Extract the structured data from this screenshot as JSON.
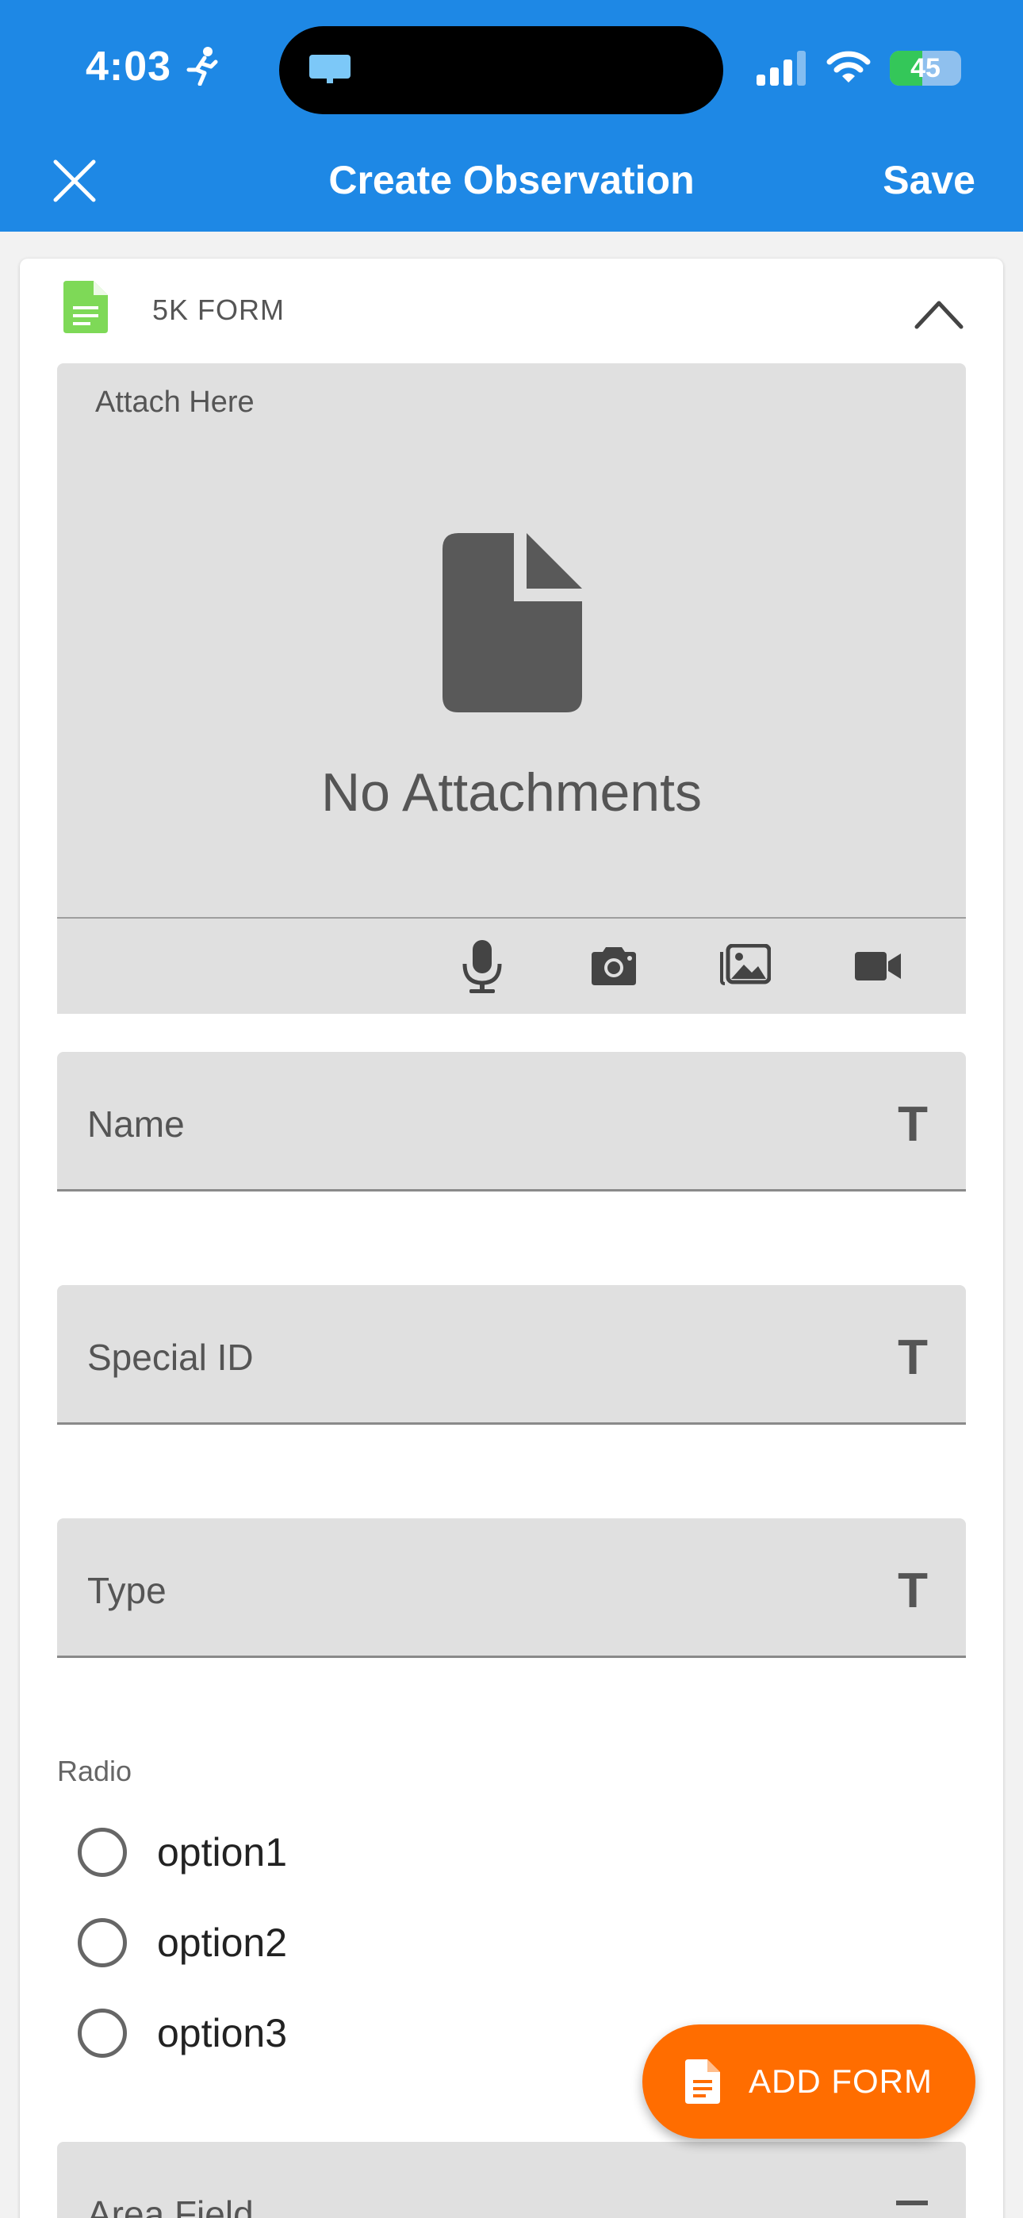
{
  "status_bar": {
    "time": "4:03",
    "battery": "45",
    "battery_level": 0.45
  },
  "header": {
    "title": "Create Observation",
    "save_label": "Save"
  },
  "form": {
    "title": "5K FORM",
    "attachments": {
      "label": "Attach Here",
      "empty_text": "No Attachments"
    },
    "fields": [
      {
        "label": "Name"
      },
      {
        "label": "Special ID"
      },
      {
        "label": "Type"
      }
    ],
    "field_type_glyph": "T",
    "radio": {
      "label": "Radio",
      "options": [
        "option1",
        "option2",
        "option3"
      ]
    },
    "area_field": {
      "label": "Area Field"
    }
  },
  "fab": {
    "label": "ADD FORM"
  },
  "colors": {
    "primary": "#1e88e5",
    "accent": "#ff6d00",
    "form_icon": "#7ed957"
  },
  "icons": [
    "run-icon",
    "close-icon",
    "signal-icon",
    "wifi-icon",
    "battery-icon",
    "document-icon",
    "chevron-up-icon",
    "microphone-icon",
    "camera-icon",
    "gallery-icon",
    "video-icon"
  ]
}
